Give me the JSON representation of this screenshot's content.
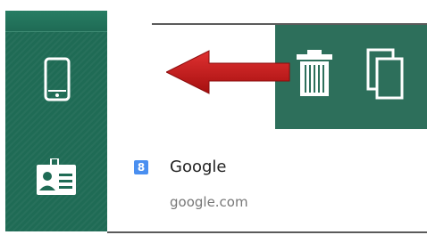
{
  "sidebar": {
    "items": [
      {
        "icon": "phone-icon"
      },
      {
        "icon": "contact-card-icon"
      }
    ]
  },
  "swipe_actions": {
    "background_color": "#2d6f5b",
    "items": [
      {
        "icon": "trash-icon"
      },
      {
        "icon": "copy-icon"
      }
    ]
  },
  "annotation": {
    "icon": "left-arrow-icon",
    "color": "#c41b1b"
  },
  "result": {
    "favicon_text": "8",
    "title": "Google",
    "url": "google.com"
  },
  "colors": {
    "sidebar": "#1f6b55",
    "favicon": "#4a8ff0"
  }
}
